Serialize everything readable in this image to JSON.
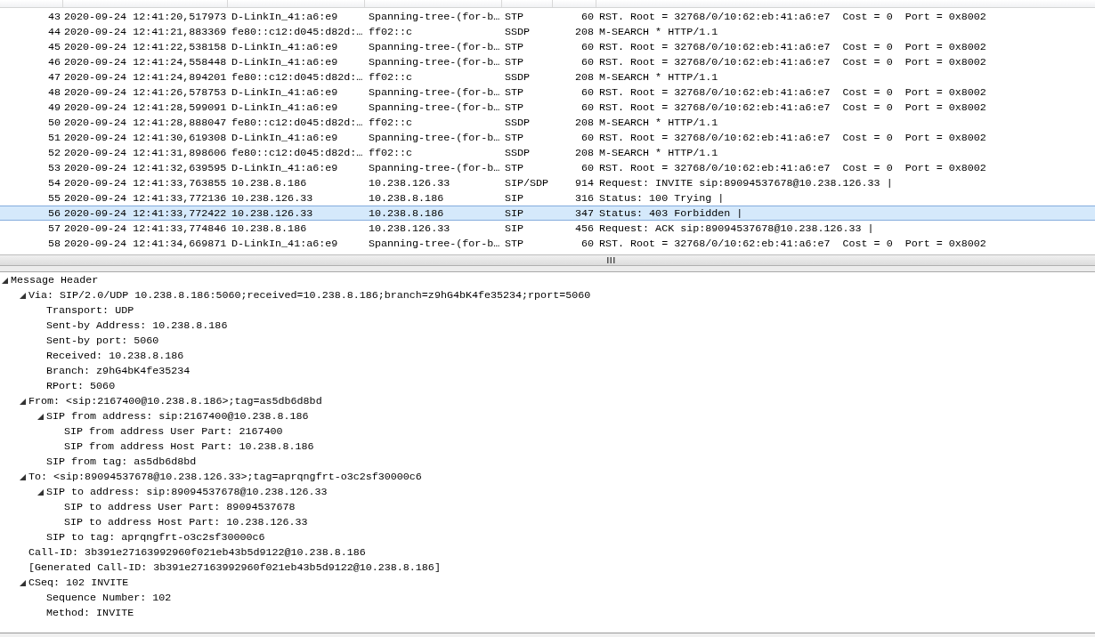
{
  "packet_list": {
    "rows": [
      {
        "no": "43",
        "time": "2020-09-24 12:41:20,517973",
        "source": "D-LinkIn_41:a6:e9",
        "destination": "Spanning-tree-(for-b…",
        "protocol": "STP",
        "length": "60",
        "info": "RST. Root = 32768/0/10:62:eb:41:a6:e7  Cost = 0  Port = 0x8002",
        "selected": false
      },
      {
        "no": "44",
        "time": "2020-09-24 12:41:21,883369",
        "source": "fe80::c12:d045:d82d:…",
        "destination": "ff02::c",
        "protocol": "SSDP",
        "length": "208",
        "info": "M-SEARCH * HTTP/1.1",
        "selected": false
      },
      {
        "no": "45",
        "time": "2020-09-24 12:41:22,538158",
        "source": "D-LinkIn_41:a6:e9",
        "destination": "Spanning-tree-(for-b…",
        "protocol": "STP",
        "length": "60",
        "info": "RST. Root = 32768/0/10:62:eb:41:a6:e7  Cost = 0  Port = 0x8002",
        "selected": false
      },
      {
        "no": "46",
        "time": "2020-09-24 12:41:24,558448",
        "source": "D-LinkIn_41:a6:e9",
        "destination": "Spanning-tree-(for-b…",
        "protocol": "STP",
        "length": "60",
        "info": "RST. Root = 32768/0/10:62:eb:41:a6:e7  Cost = 0  Port = 0x8002",
        "selected": false
      },
      {
        "no": "47",
        "time": "2020-09-24 12:41:24,894201",
        "source": "fe80::c12:d045:d82d:…",
        "destination": "ff02::c",
        "protocol": "SSDP",
        "length": "208",
        "info": "M-SEARCH * HTTP/1.1",
        "selected": false
      },
      {
        "no": "48",
        "time": "2020-09-24 12:41:26,578753",
        "source": "D-LinkIn_41:a6:e9",
        "destination": "Spanning-tree-(for-b…",
        "protocol": "STP",
        "length": "60",
        "info": "RST. Root = 32768/0/10:62:eb:41:a6:e7  Cost = 0  Port = 0x8002",
        "selected": false
      },
      {
        "no": "49",
        "time": "2020-09-24 12:41:28,599091",
        "source": "D-LinkIn_41:a6:e9",
        "destination": "Spanning-tree-(for-b…",
        "protocol": "STP",
        "length": "60",
        "info": "RST. Root = 32768/0/10:62:eb:41:a6:e7  Cost = 0  Port = 0x8002",
        "selected": false
      },
      {
        "no": "50",
        "time": "2020-09-24 12:41:28,888047",
        "source": "fe80::c12:d045:d82d:…",
        "destination": "ff02::c",
        "protocol": "SSDP",
        "length": "208",
        "info": "M-SEARCH * HTTP/1.1",
        "selected": false
      },
      {
        "no": "51",
        "time": "2020-09-24 12:41:30,619308",
        "source": "D-LinkIn_41:a6:e9",
        "destination": "Spanning-tree-(for-b…",
        "protocol": "STP",
        "length": "60",
        "info": "RST. Root = 32768/0/10:62:eb:41:a6:e7  Cost = 0  Port = 0x8002",
        "selected": false
      },
      {
        "no": "52",
        "time": "2020-09-24 12:41:31,898606",
        "source": "fe80::c12:d045:d82d:…",
        "destination": "ff02::c",
        "protocol": "SSDP",
        "length": "208",
        "info": "M-SEARCH * HTTP/1.1",
        "selected": false
      },
      {
        "no": "53",
        "time": "2020-09-24 12:41:32,639595",
        "source": "D-LinkIn_41:a6:e9",
        "destination": "Spanning-tree-(for-b…",
        "protocol": "STP",
        "length": "60",
        "info": "RST. Root = 32768/0/10:62:eb:41:a6:e7  Cost = 0  Port = 0x8002",
        "selected": false
      },
      {
        "no": "54",
        "time": "2020-09-24 12:41:33,763855",
        "source": "10.238.8.186",
        "destination": "10.238.126.33",
        "protocol": "SIP/SDP",
        "length": "914",
        "info": "Request: INVITE sip:89094537678@10.238.126.33 |",
        "selected": false
      },
      {
        "no": "55",
        "time": "2020-09-24 12:41:33,772136",
        "source": "10.238.126.33",
        "destination": "10.238.8.186",
        "protocol": "SIP",
        "length": "316",
        "info": "Status: 100 Trying |",
        "selected": false
      },
      {
        "no": "56",
        "time": "2020-09-24 12:41:33,772422",
        "source": "10.238.126.33",
        "destination": "10.238.8.186",
        "protocol": "SIP",
        "length": "347",
        "info": "Status: 403 Forbidden |",
        "selected": true
      },
      {
        "no": "57",
        "time": "2020-09-24 12:41:33,774846",
        "source": "10.238.8.186",
        "destination": "10.238.126.33",
        "protocol": "SIP",
        "length": "456",
        "info": "Request: ACK sip:89094537678@10.238.126.33 |",
        "selected": false
      },
      {
        "no": "58",
        "time": "2020-09-24 12:41:34,669871",
        "source": "D-LinkIn_41:a6:e9",
        "destination": "Spanning-tree-(for-b…",
        "protocol": "STP",
        "length": "60",
        "info": "RST. Root = 32768/0/10:62:eb:41:a6:e7  Cost = 0  Port = 0x8002",
        "selected": false
      }
    ]
  },
  "details": {
    "tree": [
      {
        "label": "Message Header",
        "expanded": true,
        "children": [
          {
            "label": "Via: SIP/2.0/UDP 10.238.8.186:5060;received=10.238.8.186;branch=z9hG4bK4fe35234;rport=5060",
            "expanded": true,
            "children": [
              {
                "label": "Transport: UDP"
              },
              {
                "label": "Sent-by Address: 10.238.8.186"
              },
              {
                "label": "Sent-by port: 5060"
              },
              {
                "label": "Received: 10.238.8.186"
              },
              {
                "label": "Branch: z9hG4bK4fe35234"
              },
              {
                "label": "RPort: 5060"
              }
            ]
          },
          {
            "label": "From: <sip:2167400@10.238.8.186>;tag=as5db6d8bd",
            "expanded": true,
            "children": [
              {
                "label": "SIP from address: sip:2167400@10.238.8.186",
                "expanded": true,
                "children": [
                  {
                    "label": "SIP from address User Part: 2167400"
                  },
                  {
                    "label": "SIP from address Host Part: 10.238.8.186"
                  }
                ]
              },
              {
                "label": "SIP from tag: as5db6d8bd"
              }
            ]
          },
          {
            "label": "To: <sip:89094537678@10.238.126.33>;tag=aprqngfrt-o3c2sf30000c6",
            "expanded": true,
            "children": [
              {
                "label": "SIP to address: sip:89094537678@10.238.126.33",
                "expanded": true,
                "children": [
                  {
                    "label": "SIP to address User Part: 89094537678"
                  },
                  {
                    "label": "SIP to address Host Part: 10.238.126.33"
                  }
                ]
              },
              {
                "label": "SIP to tag: aprqngfrt-o3c2sf30000c6"
              }
            ]
          },
          {
            "label": "Call-ID: 3b391e27163992960f021eb43b5d9122@10.238.8.186"
          },
          {
            "label": "[Generated Call-ID: 3b391e27163992960f021eb43b5d9122@10.238.8.186]"
          },
          {
            "label": "CSeq: 102 INVITE",
            "expanded": true,
            "children": [
              {
                "label": "Sequence Number: 102"
              },
              {
                "label": "Method: INVITE"
              }
            ]
          }
        ]
      }
    ]
  }
}
